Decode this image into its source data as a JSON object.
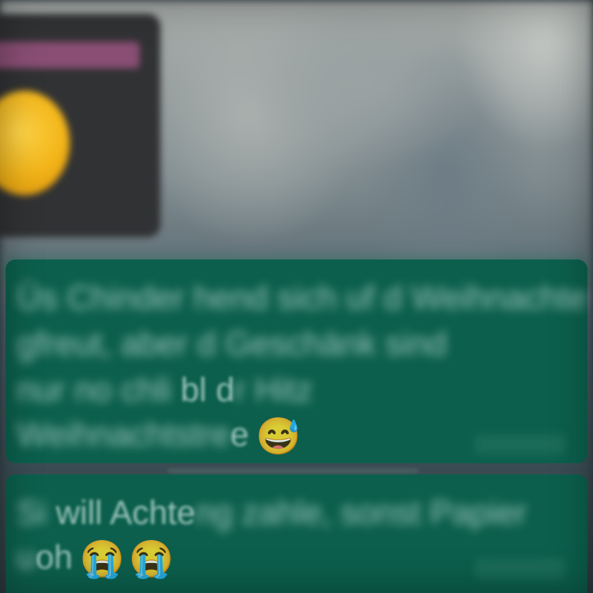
{
  "chat": {
    "shared_image": {
      "icon": "sun-emoji-icon",
      "accent_color": "#8a4e74"
    },
    "message_1": {
      "line_1": "Üs Chinder hend sich uf d Weihnachte",
      "line_2": "gfreut, aber d Geschänk sind",
      "line_3_start": "nur no chli ",
      "line_3_visible": "bl d",
      "line_3_end": "r Hitz",
      "line_4_start": "Weihnachtstre",
      "line_4_visible": "e",
      "emoji": "😅"
    },
    "message_2": {
      "line_1_start": "Si ",
      "line_1_visible": "will Achte",
      "line_1_end": "ng zahle, sonst Papier",
      "line_2_start": "u",
      "line_2_visible": "oh",
      "emojis": [
        "😭",
        "😭"
      ]
    },
    "colors": {
      "bubble": "#0c5f4d",
      "background": "#2f3b42"
    }
  }
}
